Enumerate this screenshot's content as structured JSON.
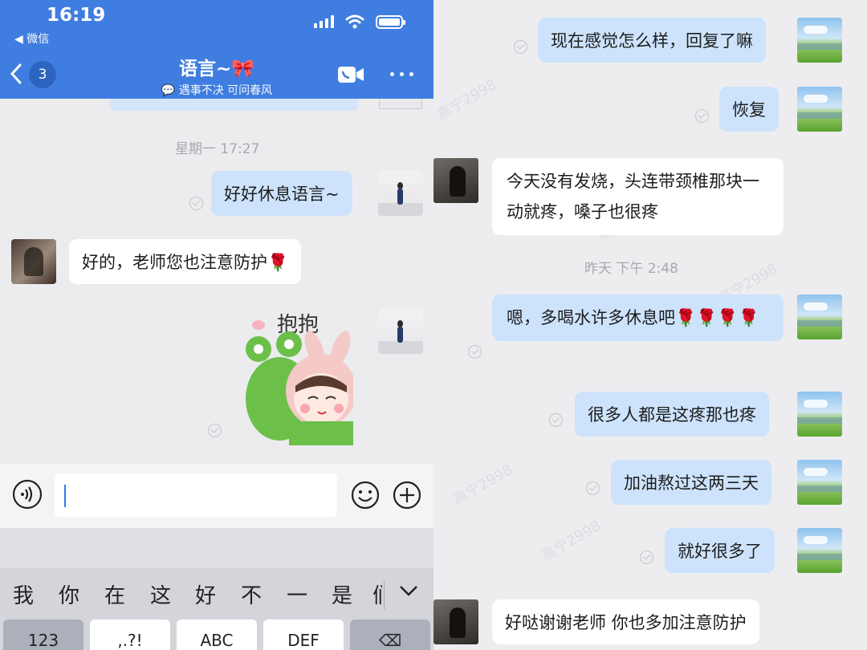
{
  "left_panel": {
    "status_bar": {
      "time": "16:19",
      "back_app": "◀ 微信"
    },
    "header": {
      "unread_count": "3",
      "title": "语言~",
      "title_emoji": "🎀",
      "subtitle": "遇事不决 可问春风"
    },
    "timestamp": "星期一 17:27",
    "messages": [
      {
        "side": "out",
        "text": "好好休息语言~"
      },
      {
        "side": "in",
        "text": "好的，老师您也注意防护🌹"
      }
    ],
    "sticker": {
      "text": "抱抱"
    },
    "keyboard": {
      "candidates": [
        "我",
        "你",
        "在",
        "这",
        "好",
        "不",
        "一",
        "是",
        "们"
      ],
      "keys": [
        "123",
        ",.?!",
        "ABC",
        "DEF",
        "⌫"
      ]
    }
  },
  "right_panel": {
    "timestamp": "昨天 下午 2:48",
    "messages": [
      {
        "side": "out",
        "text": "现在感觉怎么样，回复了嘛"
      },
      {
        "side": "out",
        "text": "恢复"
      },
      {
        "side": "in",
        "text": "今天没有发烧，头连带颈椎那块一动就疼，嗓子也很疼"
      },
      {
        "side": "out",
        "text": "嗯，多喝水许多休息吧🌹🌹🌹🌹"
      },
      {
        "side": "out",
        "text": "很多人都是这疼那也疼"
      },
      {
        "side": "out",
        "text": "加油熬过这两三天"
      },
      {
        "side": "out",
        "text": "就好很多了"
      },
      {
        "side": "in",
        "text": "好哒谢谢老师 你也多加注意防护"
      }
    ],
    "watermark": "高宁2998"
  },
  "colors": {
    "header_blue": "#3f7ee0",
    "out_bubble": "#cde3fb",
    "in_bubble": "#ffffff"
  }
}
